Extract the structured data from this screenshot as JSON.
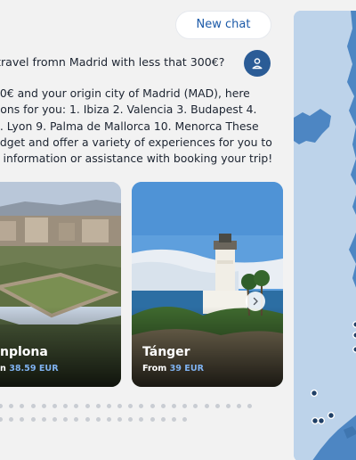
{
  "header": {
    "new_chat_label": "New chat"
  },
  "conversation": {
    "user_message": "travel fromn Madrid with less that 300€?",
    "assistant_lines": [
      "00€ and your origin city of Madrid (MAD), here",
      "tions for you: 1. Ibiza 2. Valencia 3. Budapest 4.",
      "8. Lyon 9. Palma de Mallorca 10. Menorca These",
      "udget and offer a variety of experiences for you to",
      "e information or assistance with booking your trip!"
    ]
  },
  "destinations": [
    {
      "city": "nplona",
      "price_prefix": "n",
      "price": "38.59 EUR"
    },
    {
      "city": "Tánger",
      "price_prefix": "From",
      "price": "39 EUR"
    }
  ],
  "carousel": {
    "dot_rows": [
      12,
      12
    ]
  },
  "colors": {
    "accent": "#1c5aa8",
    "avatar": "#2b5c96",
    "price": "#7fb2f0",
    "map_sea": "#bdd3ea",
    "map_land": "#4d86c3"
  },
  "icons": {
    "user_avatar": "person-icon",
    "carousel_next": "chevron-right-icon"
  }
}
